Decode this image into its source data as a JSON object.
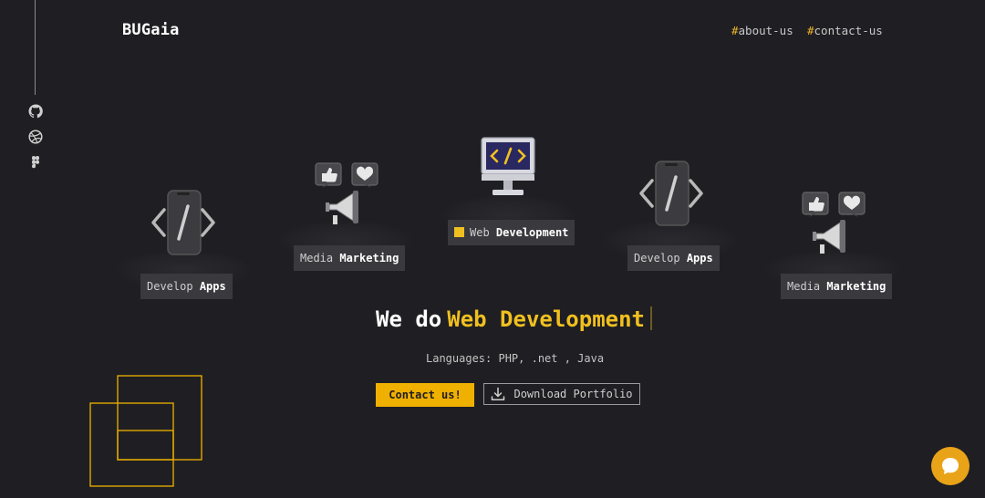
{
  "header": {
    "logo": "BUGaia",
    "nav": [
      {
        "hash": "#",
        "label": "about-us"
      },
      {
        "hash": "#",
        "label": "contact-us"
      }
    ]
  },
  "social": {
    "icons": [
      "github-icon",
      "dribbble-icon",
      "figma-icon"
    ]
  },
  "cards": [
    {
      "light": "Develop",
      "bold": "Apps",
      "icon": "code-phone-icon"
    },
    {
      "light": "Media",
      "bold": "Marketing",
      "icon": "megaphone-likes-icon"
    },
    {
      "light": "Web",
      "bold": "Development",
      "icon": "code-monitor-icon",
      "active": true
    },
    {
      "light": "Develop",
      "bold": "Apps",
      "icon": "code-phone-icon"
    },
    {
      "light": "Media",
      "bold": "Marketing",
      "icon": "megaphone-likes-icon"
    }
  ],
  "hero": {
    "prefix": "We do",
    "highlight": "Web Development",
    "languages": "Languages: PHP, .net , Java",
    "primary_button": "Contact us!",
    "secondary_button": "Download Portfolio"
  },
  "colors": {
    "background": "#1f1e22",
    "accent": "#f0c020",
    "button": "#f0b000",
    "tag": "#3a393e"
  },
  "chat": {
    "icon": "chat-bubble-icon"
  }
}
